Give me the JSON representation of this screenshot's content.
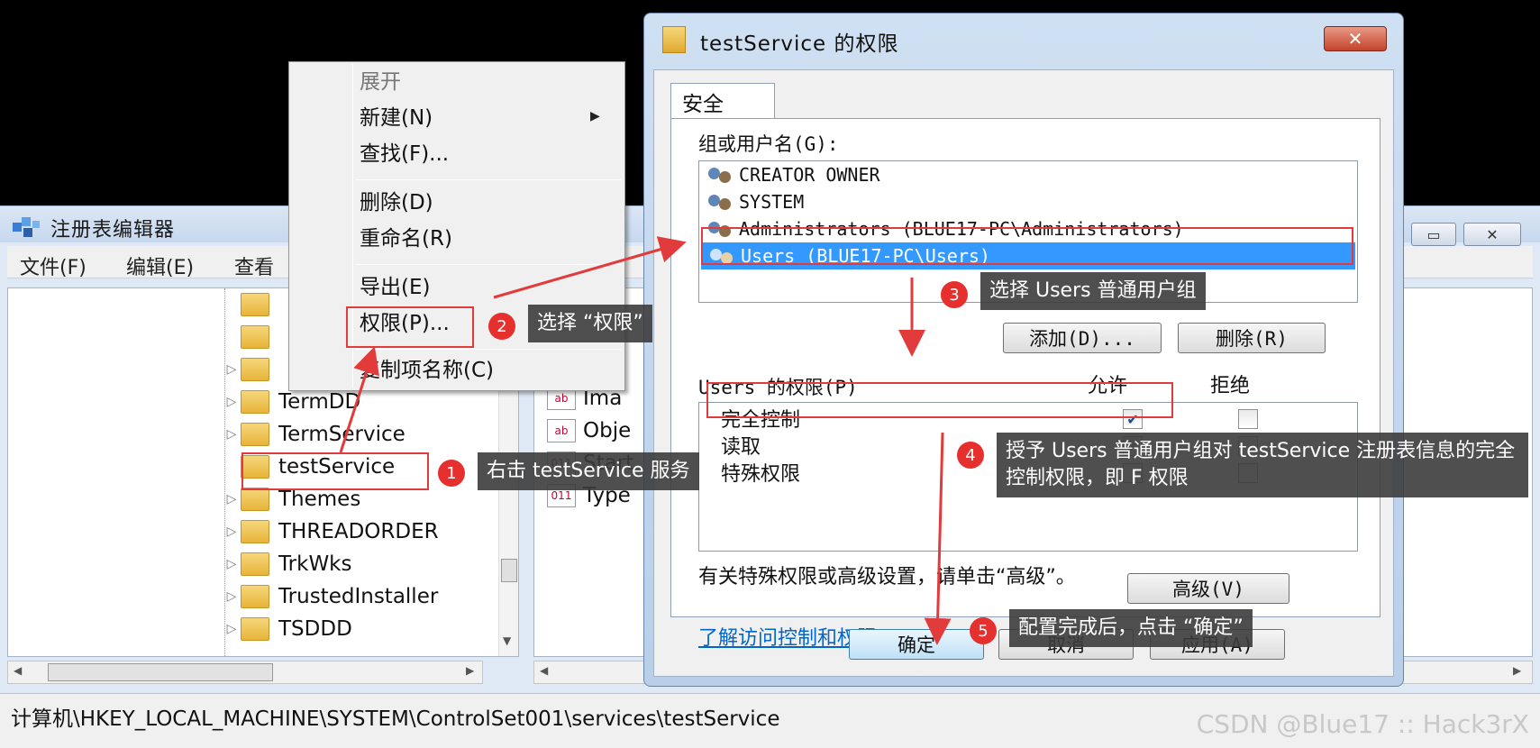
{
  "registry": {
    "title": "注册表编辑器",
    "menu": [
      "文件(F)",
      "编辑(E)",
      "查看"
    ],
    "window_buttons": [
      "▭",
      "✕"
    ],
    "tree_items": [
      {
        "label": "",
        "expander": ""
      },
      {
        "label": "",
        "expander": ""
      },
      {
        "label": "",
        "expander": "▷"
      },
      {
        "label": "TermDD",
        "expander": "▷"
      },
      {
        "label": "TermService",
        "expander": "▷"
      },
      {
        "label": "testService",
        "expander": ""
      },
      {
        "label": "Themes",
        "expander": "▷"
      },
      {
        "label": "THREADORDER",
        "expander": "▷"
      },
      {
        "label": "TrkWks",
        "expander": "▷"
      },
      {
        "label": "TrustedInstaller",
        "expander": "▷"
      },
      {
        "label": "TSDDD",
        "expander": "▷"
      }
    ],
    "value_items": [
      {
        "label": "Ima",
        "icon": "ab"
      },
      {
        "label": "Obje",
        "icon": "ab"
      },
      {
        "label": "Start",
        "icon": "011"
      },
      {
        "label": "Type",
        "icon": "011"
      }
    ],
    "status_path": "计算机\\HKEY_LOCAL_MACHINE\\SYSTEM\\ControlSet001\\services\\testService",
    "watermark": "CSDN @Blue17 :: Hack3rX"
  },
  "context_menu": {
    "items": [
      {
        "label": "展开",
        "disabled": true
      },
      {
        "label": "新建(N)",
        "submenu": "▶"
      },
      {
        "label": "查找(F)..."
      },
      {
        "label": "删除(D)"
      },
      {
        "label": "重命名(R)"
      },
      {
        "label": "导出(E)"
      },
      {
        "label": "权限(P)..."
      },
      {
        "label": "复制项名称(C)"
      }
    ]
  },
  "dialog": {
    "title": "testService 的权限",
    "close": "✕",
    "tab": "安全",
    "group_label": "组或用户名(G):",
    "users": [
      "CREATOR OWNER",
      "SYSTEM",
      "Administrators (BLUE17-PC\\Administrators)",
      "Users (BLUE17-PC\\Users)"
    ],
    "add_button": "添加(D)...",
    "remove_button": "删除(R)",
    "perm_label": "Users 的权限(P)",
    "allow_header": "允许",
    "deny_header": "拒绝",
    "permissions": [
      {
        "name": "完全控制",
        "allow": "✔",
        "deny": ""
      },
      {
        "name": "读取",
        "allow": "✔",
        "deny": ""
      },
      {
        "name": "特殊权限",
        "allow": "",
        "deny": ""
      }
    ],
    "advanced_text": "有关特殊权限或高级设置，请单击“高级”。",
    "advanced_button": "高级(V)",
    "link": "了解访问控制和权限",
    "ok": "确定",
    "cancel": "取消",
    "apply": "应用(A)"
  },
  "annotations": [
    {
      "num": "1",
      "text": "右击 testService 服务"
    },
    {
      "num": "2",
      "text": "选择 “权限”"
    },
    {
      "num": "3",
      "text": "选择 Users 普通用户组"
    },
    {
      "num": "4",
      "text": "授予 Users 普通用户组对 testService 注册表信息的完全控制权限，即 F 权限"
    },
    {
      "num": "5",
      "text": "配置完成后，点击 “确定”"
    }
  ],
  "colors": {
    "annotation_red": "#e23b3b",
    "selection_blue": "#3399ff"
  }
}
